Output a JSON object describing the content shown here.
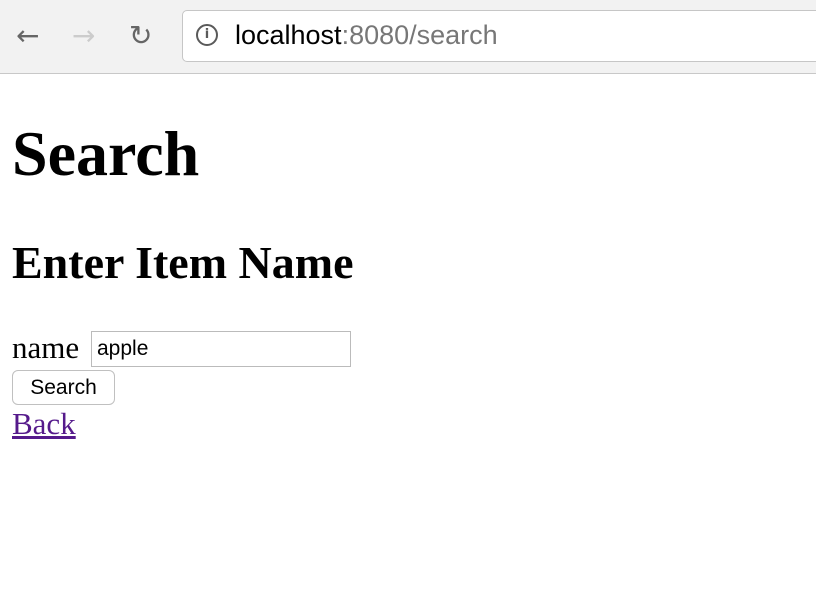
{
  "browser": {
    "url_host": "localhost",
    "url_rest": ":8080/search"
  },
  "page": {
    "title": "Search",
    "subtitle": "Enter Item Name",
    "field_label": "name",
    "field_value": "apple",
    "button_label": "Search",
    "back_link": "Back"
  }
}
